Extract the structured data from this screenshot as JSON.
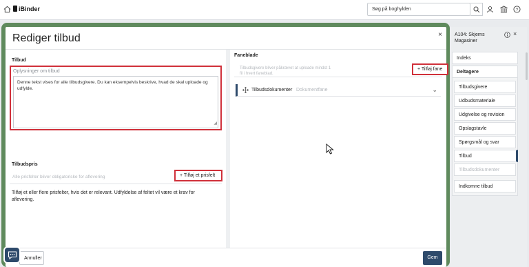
{
  "app": {
    "name": "iBinder"
  },
  "search": {
    "placeholder": "Søg på boghylden"
  },
  "icons": {
    "home": "home-icon",
    "search": "search-icon",
    "user": "user-icon",
    "library": "library-icon",
    "help": "help-icon",
    "close": "close-icon",
    "info": "info-icon",
    "plus": "plus-icon",
    "move": "move-icon",
    "chevron": "chevron-down-icon",
    "chat": "chat-icon"
  },
  "colors": {
    "primary": "#2e4a6b",
    "frame": "#5f8a5d",
    "highlight": "#d0303a"
  },
  "modal": {
    "title": "Rediger tilbud",
    "close": "×",
    "left": {
      "section_title": "Tilbud",
      "textarea_label": "Oplysninger om tilbud",
      "textarea_value": "Denne tekst vises for alle tilbudsgivere. Du kan eksempelvis beskrive, hvad de skal uploade og udfylde.",
      "price_title": "Tilbudspris",
      "price_placeholder": "Alle prisfelter bliver obligatoriske for aflevering",
      "add_price_label": "Tilføj et prisfelt",
      "price_help": "Tilføj et eller flere prisfelter, hvis det er relevant. Udfyldelse af feltet vil være et krav for aflevering."
    },
    "right": {
      "section_title": "Faneblade",
      "tabs_placeholder_line1": "Tilbudsgivere bliver påkrævet at uploade mindst 1",
      "tabs_placeholder_line2": "fil i hvert faneblad.",
      "add_tab_label": "Tilføj fane",
      "doc_name": "Tilbudsdokumenter",
      "doc_type": "Dokumentfane"
    },
    "footer": {
      "cancel_label": "Annuller",
      "save_label": "Gem"
    }
  },
  "sidebar": {
    "header": "A104: Skjerns Magasiner",
    "close": "×",
    "items": [
      {
        "label": "Indeks"
      },
      {
        "label": "Deltagere"
      },
      {
        "label": "Tilbudsgivere"
      },
      {
        "label": "Udbudsmateriale"
      },
      {
        "label": "Udgivelse og revision"
      },
      {
        "label": "Opslagstavle"
      },
      {
        "label": "Spørgsmål og svar"
      },
      {
        "label": "Tilbud"
      },
      {
        "label": "Tilbudsdokumenter"
      },
      {
        "label": "Indkomne tilbud"
      }
    ]
  }
}
